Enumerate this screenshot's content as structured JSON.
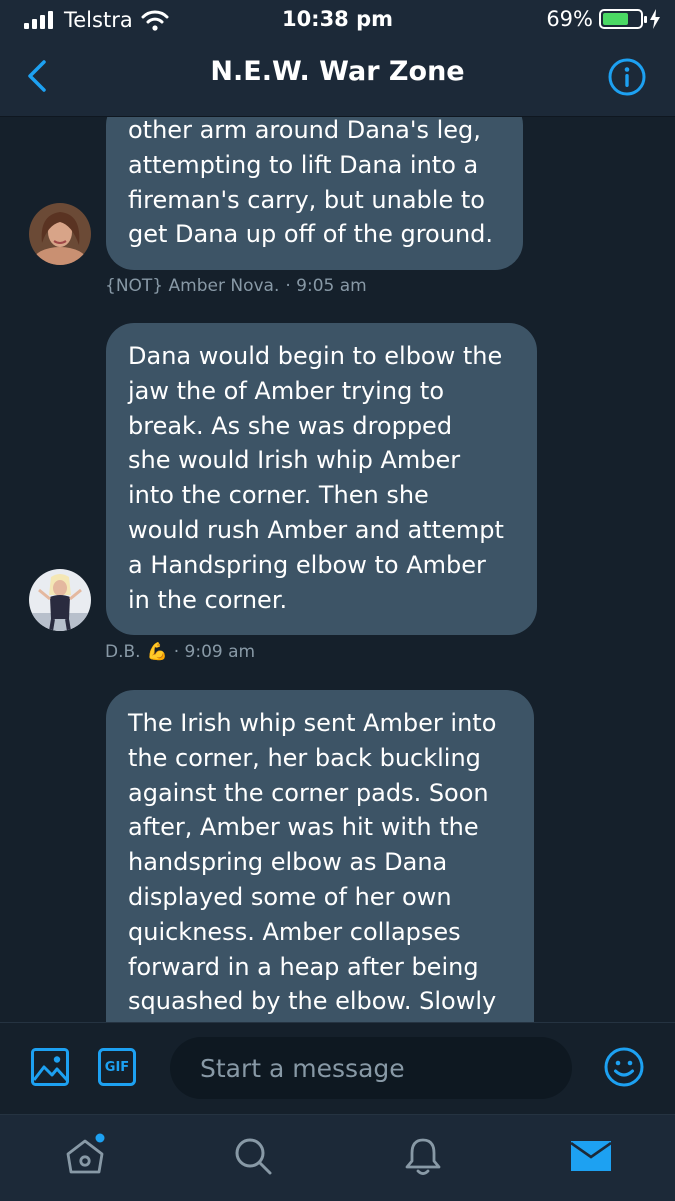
{
  "status_bar": {
    "carrier": "Telstra",
    "time": "10:38 pm",
    "battery": "69%",
    "battery_level": 0.69
  },
  "header": {
    "title": "N.E.W. War Zone"
  },
  "messages": [
    {
      "text": "other arm around Dana's leg,\nattempting to lift Dana into a\nfireman's carry, but unable to\nget Dana up off of the ground.",
      "sender": "{NOT} Amber Nova.",
      "time": "· 9:05 am"
    },
    {
      "text": "Dana would begin to elbow the\njaw the of Amber trying to\nbreak. As she was dropped\nshe would Irish whip Amber\ninto the corner. Then she\nwould rush Amber and attempt\na Handspring elbow to Amber\nin the corner.",
      "sender": "D.B.",
      "sender_emoji": "💪",
      "time": "· 9:09 am"
    },
    {
      "text": "The Irish whip sent Amber into\nthe corner, her back buckling\nagainst the corner pads. Soon\nafter, Amber was hit with the\nhandspring elbow as Dana\ndisplayed some of her own\nquickness. Amber collapses\nforward in a heap after being\nsquashed by the elbow. Slowly"
    }
  ],
  "composer": {
    "placeholder": "Start a message",
    "gif_label": "GIF"
  },
  "colors": {
    "accent": "#1da1f2",
    "bubble": "#3d5466",
    "background": "#15202b",
    "bar": "#1c2938",
    "meta": "#8899a6"
  }
}
